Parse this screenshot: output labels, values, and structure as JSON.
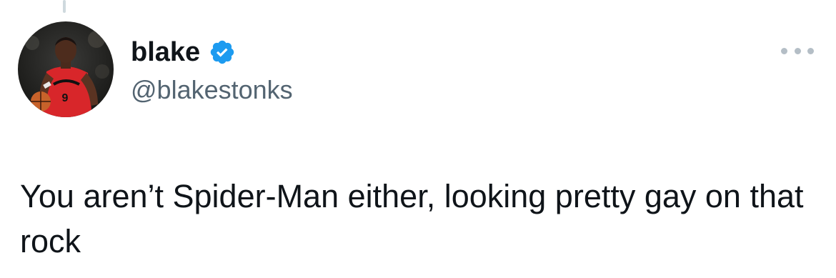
{
  "tweet": {
    "author": {
      "display_name": "blake",
      "handle": "@blakestonks",
      "verified": true,
      "avatar_icon": "profile-photo-basketball-player"
    },
    "text": "You aren’t Spider-Man either, looking pretty gay on that rock"
  },
  "colors": {
    "verified_blue": "#1d9bf0",
    "secondary_text": "#536471",
    "primary_text": "#0f1419",
    "thread_line": "#cfd9de"
  },
  "icons": {
    "verified": "verified-badge-icon",
    "more": "more-options-icon"
  }
}
